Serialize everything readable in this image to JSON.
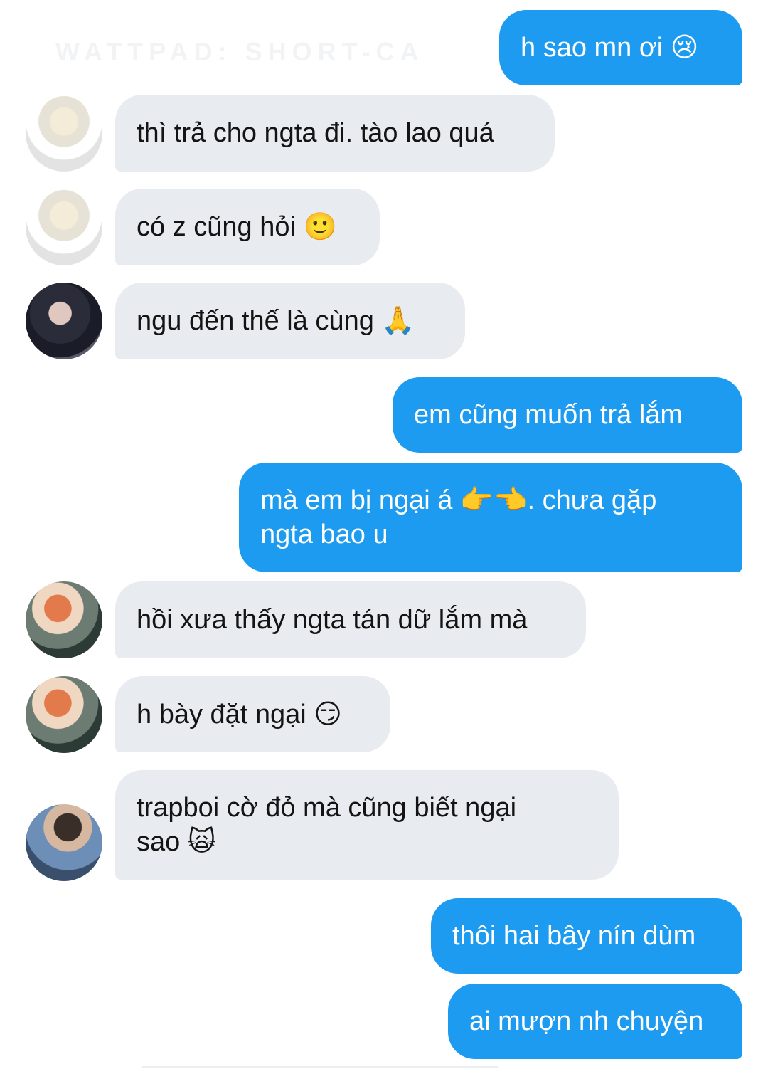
{
  "watermark": "WATTPAD: SHORT-CA",
  "messages": [
    {
      "side": "out",
      "text": "h sao mn ơi 😢"
    },
    {
      "side": "in",
      "avatar": "avatar-blond-boy",
      "text": "thì trả cho ngta đi. tào lao quá"
    },
    {
      "side": "in",
      "avatar": "avatar-blond-boy",
      "text": "có z cũng hỏi 🙂"
    },
    {
      "side": "in",
      "avatar": "avatar-dark-hair-boy",
      "text": "ngu đến thế là cùng 🙏"
    },
    {
      "side": "out",
      "text": "em cũng muốn trả lắm"
    },
    {
      "side": "out",
      "text": "mà em bị ngại á 👉👈. chưa gặp\nngta bao u"
    },
    {
      "side": "in",
      "avatar": "avatar-red-hair-boy",
      "text": "hồi xưa thấy ngta tán dữ lắm mà"
    },
    {
      "side": "in",
      "avatar": "avatar-red-hair-boy",
      "text": "h bày đặt ngại 😏"
    },
    {
      "side": "in",
      "avatar": "avatar-denim-boy",
      "text": "trapboi cờ đỏ mà cũng biết ngại\nsao 🙀"
    },
    {
      "side": "out",
      "text": "thôi hai bây nín dùm"
    },
    {
      "side": "out",
      "text": "ai mượn nh chuyện"
    }
  ]
}
